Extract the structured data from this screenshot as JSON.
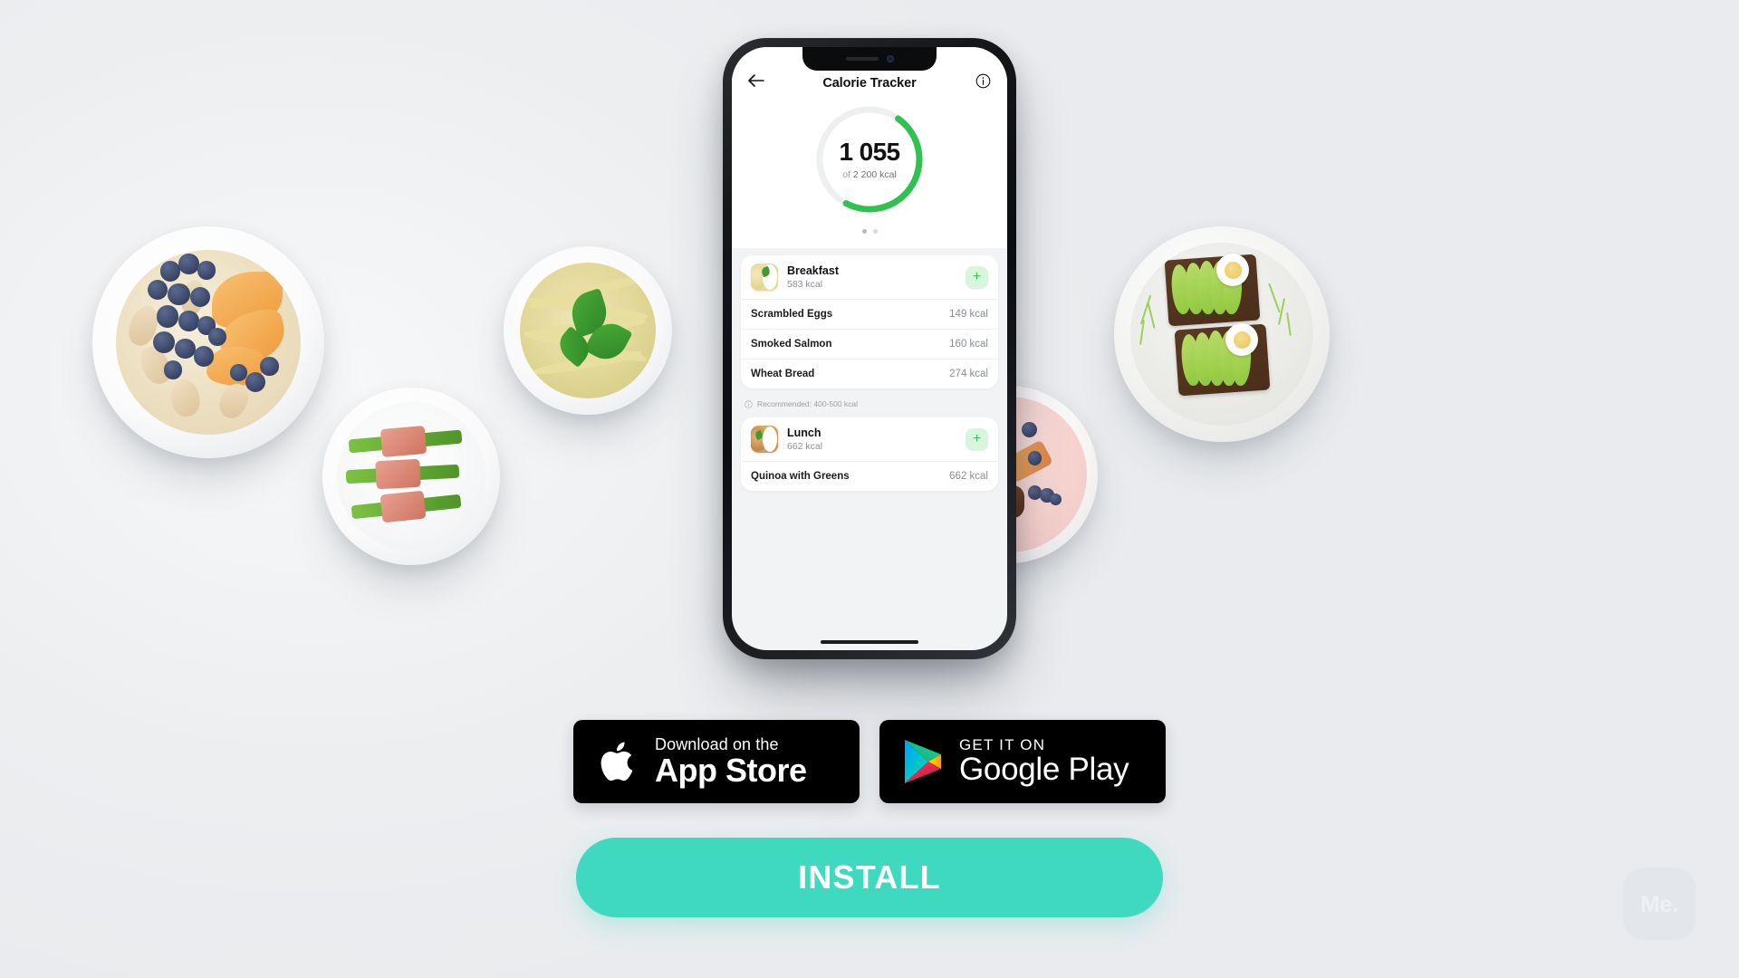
{
  "app": {
    "header": {
      "back_icon": "arrow-left-icon",
      "title": "Calorie Tracker",
      "info_icon": "info-circle-icon"
    },
    "calorie_ring": {
      "current": "1 055",
      "of_label": "of",
      "goal": "2 200 kcal",
      "percent": 48,
      "track_color": "#edeff1",
      "progress_color": "#2ec24e",
      "dots": [
        "active",
        "inactive"
      ]
    },
    "meals": [
      {
        "name": "Breakfast",
        "total": "583 kcal",
        "add_label": "+",
        "thumb": "pasta-thumb",
        "items": [
          {
            "name": "Scrambled Eggs",
            "kcal": "149 kcal"
          },
          {
            "name": "Smoked Salmon",
            "kcal": "160 kcal"
          },
          {
            "name": "Wheat Bread",
            "kcal": "274 kcal"
          }
        ],
        "note": "Recommended: 400-500 kcal"
      },
      {
        "name": "Lunch",
        "total": "662 kcal",
        "add_label": "+",
        "thumb": "spaghetti-thumb",
        "items": [
          {
            "name": "Quinoa with Greens",
            "kcal": "662 kcal"
          }
        ],
        "note": ""
      }
    ]
  },
  "badges": {
    "app_store": {
      "icon": "apple-logo-icon",
      "small": "Download on the",
      "big": "App Store"
    },
    "google_play": {
      "icon": "google-play-triangle-icon",
      "small": "GET IT ON",
      "big": "Google Play"
    }
  },
  "install": {
    "label": "INSTALL",
    "color": "#3fd9c0"
  },
  "watermark": {
    "label": "Me."
  },
  "plates": [
    {
      "name": "oatmeal-blueberry-peach-bowl"
    },
    {
      "name": "pesto-pasta-basil-plate"
    },
    {
      "name": "green-spinach-soup-bowl"
    },
    {
      "name": "bacon-wrapped-asparagus-plate"
    },
    {
      "name": "pink-dessert-tarts-plate"
    },
    {
      "name": "avocado-toast-egg-plate"
    }
  ]
}
